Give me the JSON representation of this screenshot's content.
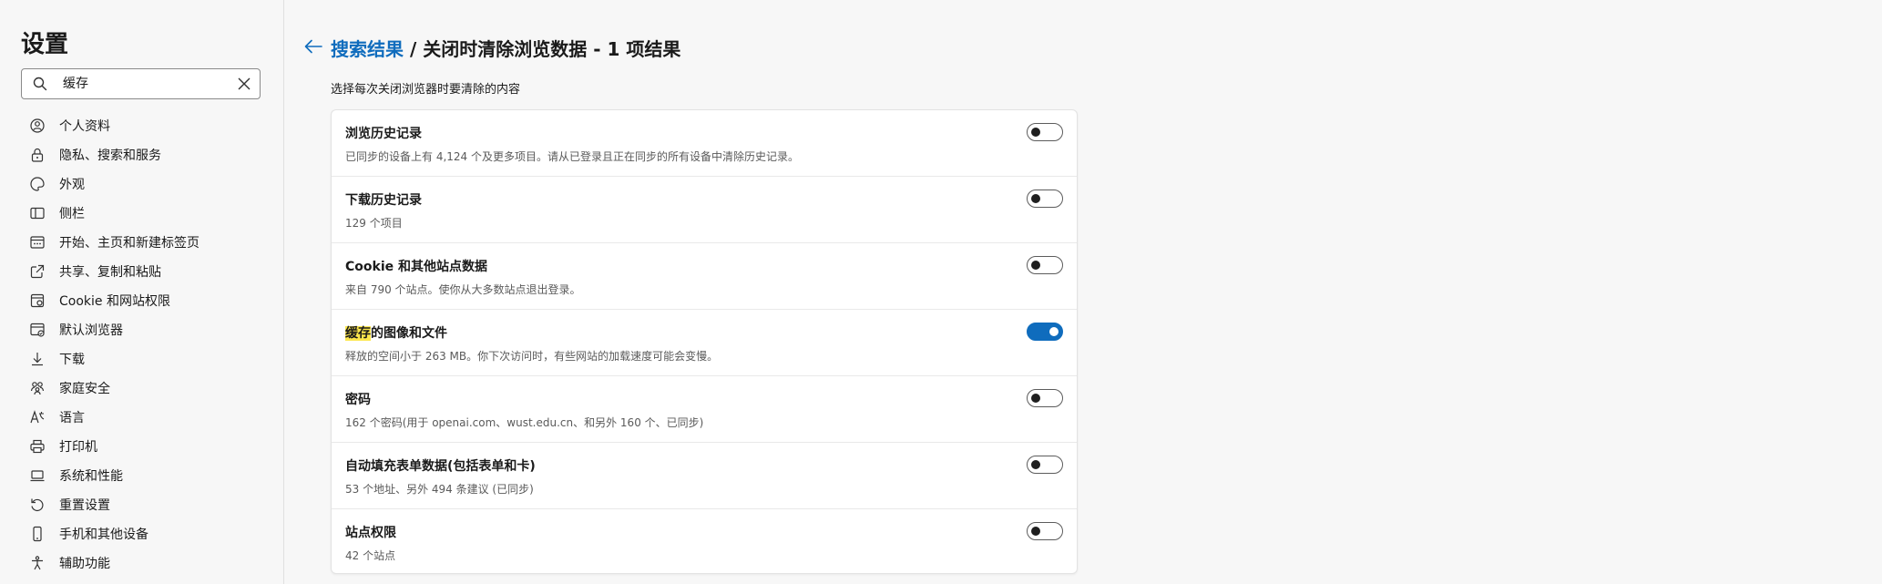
{
  "sidebar": {
    "title": "设置",
    "search": {
      "value": "缓存",
      "icon": "search-icon",
      "clear_icon": "close-icon"
    },
    "items": [
      {
        "label": "个人资料",
        "icon": "profile-icon"
      },
      {
        "label": "隐私、搜索和服务",
        "icon": "lock-icon"
      },
      {
        "label": "外观",
        "icon": "palette-icon"
      },
      {
        "label": "侧栏",
        "icon": "sidebar-icon"
      },
      {
        "label": "开始、主页和新建标签页",
        "icon": "home-tab-icon"
      },
      {
        "label": "共享、复制和粘贴",
        "icon": "share-icon"
      },
      {
        "label": "Cookie 和网站权限",
        "icon": "cookie-permissions-icon"
      },
      {
        "label": "默认浏览器",
        "icon": "browser-icon"
      },
      {
        "label": "下载",
        "icon": "download-icon"
      },
      {
        "label": "家庭安全",
        "icon": "family-icon"
      },
      {
        "label": "语言",
        "icon": "language-icon"
      },
      {
        "label": "打印机",
        "icon": "printer-icon"
      },
      {
        "label": "系统和性能",
        "icon": "laptop-icon"
      },
      {
        "label": "重置设置",
        "icon": "reset-icon"
      },
      {
        "label": "手机和其他设备",
        "icon": "phone-icon"
      },
      {
        "label": "辅助功能",
        "icon": "accessibility-icon"
      }
    ]
  },
  "main": {
    "breadcrumb": {
      "link": "搜索结果",
      "rest": " / 关闭时清除浏览数据 - 1 项结果"
    },
    "subtitle": "选择每次关闭浏览器时要清除的内容",
    "rows": [
      {
        "title": "浏览历史记录",
        "desc": "已同步的设备上有 4,124 个及更多项目。请从已登录且正在同步的所有设备中清除历史记录。",
        "on": false
      },
      {
        "title": "下载历史记录",
        "desc": "129 个项目",
        "on": false
      },
      {
        "title": "Cookie 和其他站点数据",
        "desc": "来自 790 个站点。使你从大多数站点退出登录。",
        "on": false
      },
      {
        "title_highlight": "缓存",
        "title_rest": "的图像和文件",
        "desc": "释放的空间小于 263 MB。你下次访问时，有些网站的加载速度可能会变慢。",
        "on": true
      },
      {
        "title": "密码",
        "desc": "162 个密码(用于 openai.com、wust.edu.cn、和另外 160 个、已同步)",
        "on": false
      },
      {
        "title": "自动填充表单数据(包括表单和卡)",
        "desc": "53 个地址、另外 494 条建议 (已同步)",
        "on": false
      },
      {
        "title": "站点权限",
        "desc": "42 个站点",
        "on": false
      }
    ],
    "colors": {
      "accent": "#0f6cbd",
      "highlight": "#fde74c"
    }
  }
}
